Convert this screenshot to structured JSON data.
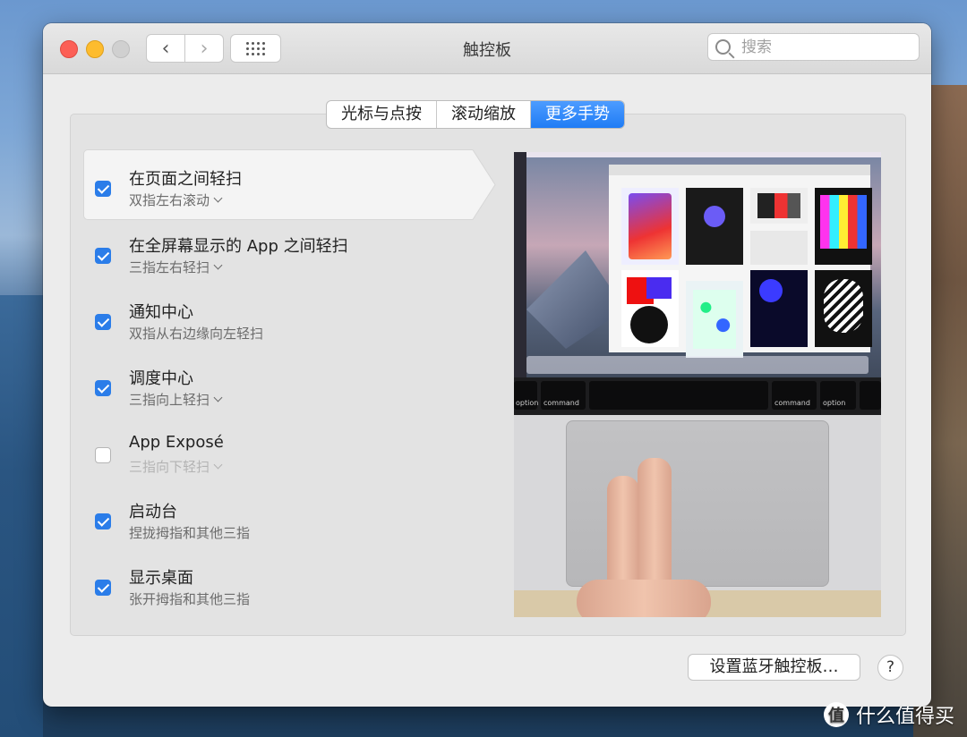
{
  "window": {
    "title": "触控板",
    "search_placeholder": "搜索"
  },
  "tabs": [
    {
      "label": "光标与点按",
      "active": false
    },
    {
      "label": "滚动缩放",
      "active": false
    },
    {
      "label": "更多手势",
      "active": true
    }
  ],
  "gestures": [
    {
      "title": "在页面之间轻扫",
      "subtitle": "双指左右滚动",
      "checked": true,
      "has_dropdown": true
    },
    {
      "title": "在全屏幕显示的 App 之间轻扫",
      "subtitle": "三指左右轻扫",
      "checked": true,
      "has_dropdown": true
    },
    {
      "title": "通知中心",
      "subtitle": "双指从右边缘向左轻扫",
      "checked": true,
      "has_dropdown": false
    },
    {
      "title": "调度中心",
      "subtitle": "三指向上轻扫",
      "checked": true,
      "has_dropdown": true
    },
    {
      "title": "App Exposé",
      "subtitle": "三指向下轻扫",
      "checked": false,
      "has_dropdown": true
    },
    {
      "title": "启动台",
      "subtitle": "捏拢拇指和其他三指",
      "checked": true,
      "has_dropdown": false
    },
    {
      "title": "显示桌面",
      "subtitle": "张开拇指和其他三指",
      "checked": true,
      "has_dropdown": false
    }
  ],
  "preview": {
    "keys": [
      "option",
      "command",
      "command",
      "option"
    ]
  },
  "footer": {
    "bluetooth_button": "设置蓝牙触控板…",
    "help_label": "?"
  },
  "watermark": {
    "logo": "值",
    "text": "什么值得买"
  },
  "colors": {
    "accent": "#2b7de9",
    "tab_active": "#1f7cf5"
  }
}
